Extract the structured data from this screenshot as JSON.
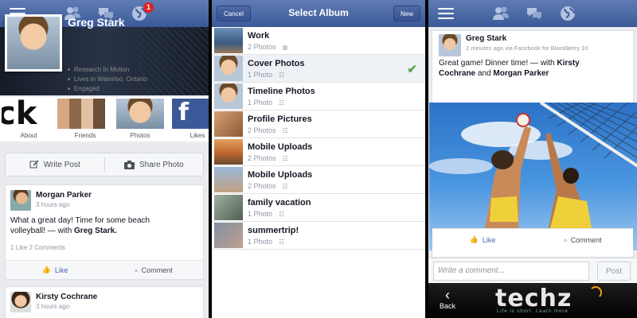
{
  "colors": {
    "brand": "#3b5998",
    "check": "#57a64a",
    "link": "#4267b2"
  },
  "panel1": {
    "profile": {
      "name": "Greg Stark",
      "work": "Research In Motion",
      "location": "Lives in Waterloo, Ontario",
      "status": "Engaged"
    },
    "tiles": [
      "About",
      "Friends",
      "Photos",
      "Likes"
    ],
    "actions": {
      "write_post": "Write Post",
      "share_photo": "Share Photo"
    },
    "posts": [
      {
        "author": "Morgan Parker",
        "time": "3 hours ago",
        "text1": "What a great day! Time for some beach",
        "text2": "volleyball! — with ",
        "tagged": "Greg Stark.",
        "meta": "1 Like  2 Comments",
        "like": "Like",
        "comment": "Comment"
      },
      {
        "author": "Kirsty Cochrane",
        "time": "3 hours ago"
      }
    ],
    "notification_count": "1"
  },
  "panel2": {
    "cancel": "Cancel",
    "title": "Select Album",
    "new": "New",
    "albums": [
      {
        "name": "Work",
        "count": "2 Photos",
        "icon": "globe-icon"
      },
      {
        "name": "Cover Photos",
        "count": "1 Photo",
        "icon": "friends-icon",
        "selected": true
      },
      {
        "name": "Timeline Photos",
        "count": "1 Photo",
        "icon": "friends-icon"
      },
      {
        "name": "Profile Pictures",
        "count": "2 Photos",
        "icon": "friends-icon"
      },
      {
        "name": "Mobile Uploads",
        "count": "2 Photos",
        "icon": "friends-icon"
      },
      {
        "name": "Mobile Uploads",
        "count": "2 Photos",
        "icon": "friends-icon"
      },
      {
        "name": "family vacation",
        "count": "1 Photo",
        "icon": "friends-icon"
      },
      {
        "name": "summertrip!",
        "count": "1 Photo",
        "icon": "friends-icon"
      }
    ]
  },
  "panel3": {
    "author": "Greg Stark",
    "time": "2 minutes ago via Facebook for BlackBerry 10",
    "text1": "Great game! Dinner time! — with ",
    "tag1": "Kirsty",
    "tag1b": "Cochrane",
    "text2": " and ",
    "tag2": "Morgan Parker",
    "like": "Like",
    "comment": "Comment",
    "comment_placeholder": "Write a comment...",
    "post": "Post",
    "back": "Back",
    "watermark": "techz",
    "watermark_tag": "Life is short. Learn more"
  }
}
